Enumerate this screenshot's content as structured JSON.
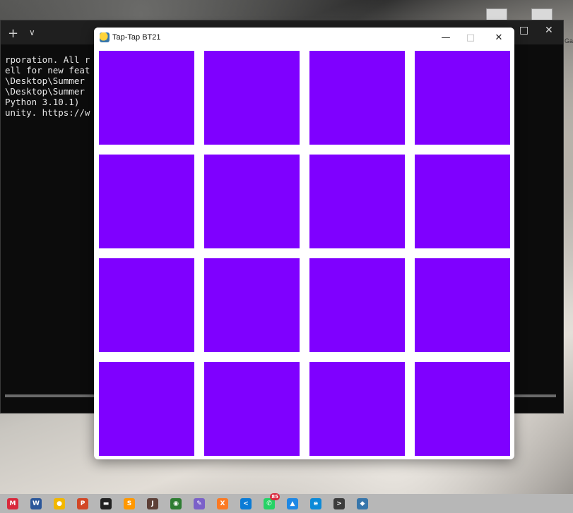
{
  "game_window": {
    "title": "Tap-Tap BT21",
    "controls": {
      "minimize": "—",
      "maximize": "□",
      "close": "✕"
    },
    "tile_color": "#7f00ff",
    "grid": {
      "rows": 4,
      "columns": 4
    }
  },
  "terminal": {
    "tab_plus": "+",
    "tab_chevron": "∨",
    "lines": [
      "rporation. All r",
      "",
      "ell for new feat",
      "",
      "\\Desktop\\Summer",
      "\\Desktop\\Summer",
      "Python 3.10.1)",
      "unity. https://w"
    ],
    "controls": {
      "maximize": "□",
      "close": "✕"
    }
  },
  "desktop": {
    "edge_label": "Ga"
  },
  "taskbar": {
    "icons": [
      {
        "name": "mcafee-icon",
        "color": "#d9293c",
        "glyph": "M"
      },
      {
        "name": "word-icon",
        "color": "#2b579a",
        "glyph": "W"
      },
      {
        "name": "chrome-icon",
        "color": "#f2b700",
        "glyph": "●"
      },
      {
        "name": "powerpoint-icon",
        "color": "#d24726",
        "glyph": "P"
      },
      {
        "name": "terminal-icon",
        "color": "#222222",
        "glyph": "▬"
      },
      {
        "name": "sublime-icon",
        "color": "#ff9800",
        "glyph": "S"
      },
      {
        "name": "java-icon",
        "color": "#5d4037",
        "glyph": "J"
      },
      {
        "name": "green-app-icon",
        "color": "#2e7d32",
        "glyph": "◉"
      },
      {
        "name": "paint-icon",
        "color": "#7b61c9",
        "glyph": "✎"
      },
      {
        "name": "xampp-icon",
        "color": "#fb7a24",
        "glyph": "X"
      },
      {
        "name": "vscode-icon",
        "color": "#0a7bd6",
        "glyph": "<"
      },
      {
        "name": "whatsapp-icon",
        "color": "#25d366",
        "glyph": "✆",
        "badge": "85"
      },
      {
        "name": "photos-icon",
        "color": "#1e88e5",
        "glyph": "▲"
      },
      {
        "name": "edge-icon",
        "color": "#0c8ad8",
        "glyph": "e"
      },
      {
        "name": "cmd-icon",
        "color": "#3c3c3c",
        "glyph": ">"
      },
      {
        "name": "python-icon",
        "color": "#3776ab",
        "glyph": "◆"
      }
    ]
  }
}
